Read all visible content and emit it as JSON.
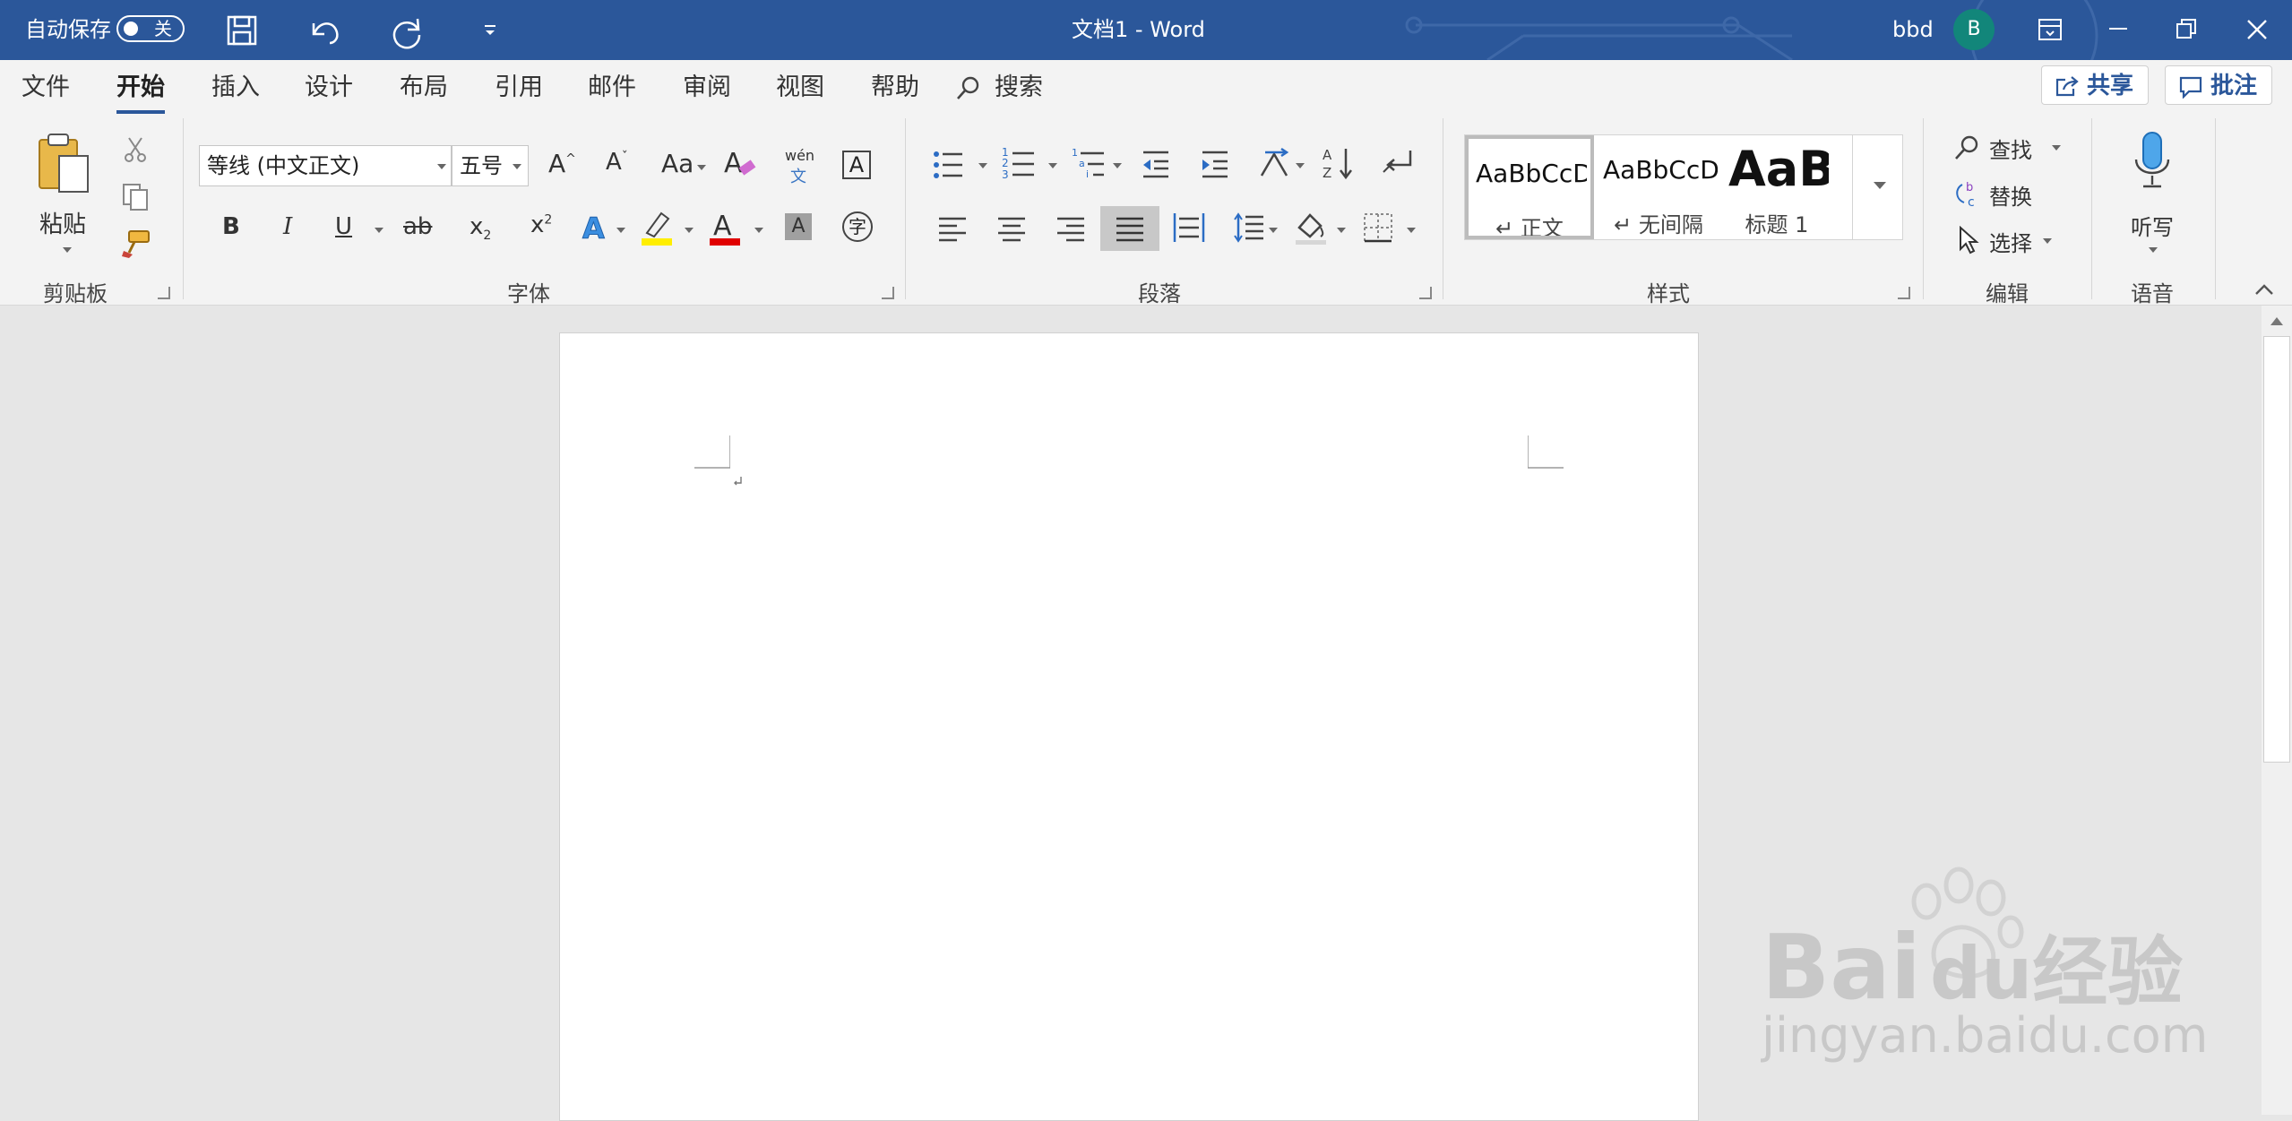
{
  "titlebar": {
    "autosave_label": "自动保存",
    "autosave_state": "关",
    "doc_title": "文档1  -  Word",
    "user_name": "bbd",
    "avatar_letter": "B",
    "bg_color": "#2b579a"
  },
  "tabs": {
    "items": [
      {
        "label": "文件"
      },
      {
        "label": "开始"
      },
      {
        "label": "插入"
      },
      {
        "label": "设计"
      },
      {
        "label": "布局"
      },
      {
        "label": "引用"
      },
      {
        "label": "邮件"
      },
      {
        "label": "审阅"
      },
      {
        "label": "视图"
      },
      {
        "label": "帮助"
      }
    ],
    "active": "开始",
    "search_label": "搜索",
    "share_label": "共享",
    "comment_label": "批注"
  },
  "ribbon": {
    "clipboard": {
      "paste_label": "粘贴",
      "group_label": "剪贴板"
    },
    "font": {
      "font_name": "等线 (中文正文)",
      "font_size": "五号",
      "case_label": "Aa",
      "pinyin_top": "wén",
      "pinyin_bottom": "文",
      "bold": "B",
      "italic": "I",
      "underline": "U",
      "strike": "ab",
      "subscript": "x",
      "superscript": "x",
      "char_border": "A",
      "char_shade": "A",
      "enclose": "字",
      "group_label": "字体"
    },
    "paragraph": {
      "group_label": "段落"
    },
    "styles": {
      "items": [
        {
          "sample": "AaBbCcDc",
          "name": "↵ 正文"
        },
        {
          "sample": "AaBbCcDc",
          "name": "↵ 无间隔"
        },
        {
          "sample": "AaBl",
          "name": "标题 1"
        }
      ],
      "group_label": "样式"
    },
    "editing": {
      "find_label": "查找",
      "replace_label": "替换",
      "select_label": "选择",
      "group_label": "编辑"
    },
    "voice": {
      "dictate_label": "听写",
      "group_label": "语音"
    }
  },
  "watermark": {
    "brand": "Bai",
    "brand_tail": "du",
    "brand_cn": "经验",
    "url": "jingyan.baidu.com"
  }
}
